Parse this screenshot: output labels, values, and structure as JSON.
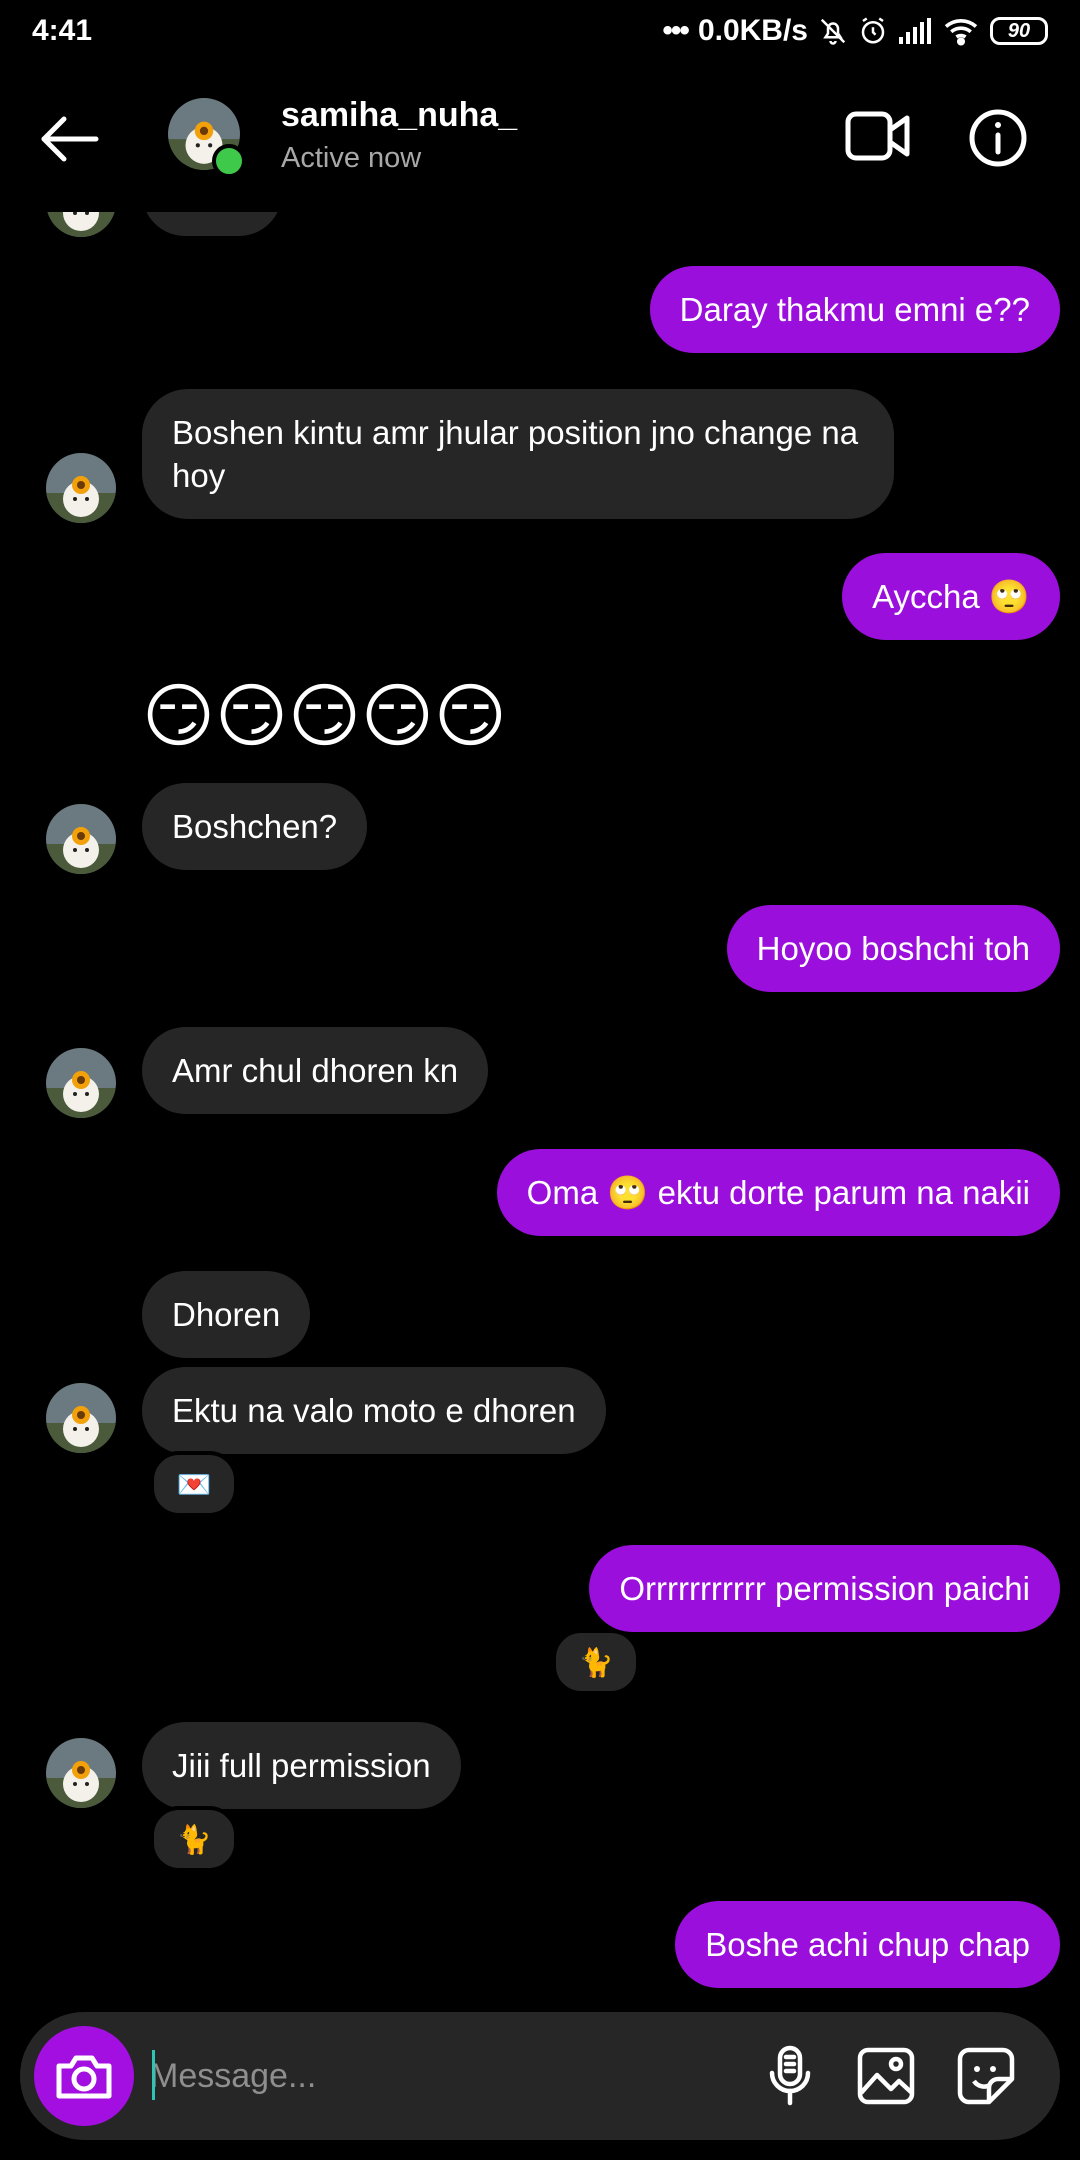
{
  "status_bar": {
    "time": "4:41",
    "network_speed": "0.0KB/s",
    "battery": "90"
  },
  "header": {
    "username": "samiha_nuha_",
    "status": "Active now"
  },
  "messages": {
    "m1": "Daray thakmu emni e??",
    "m2": "Boshen kintu amr jhular position jno change na hoy",
    "m3": "Ayccha 🙄",
    "m4_emojis": "😏😏😏😏😏",
    "m5": "Boshchen?",
    "m6": "Hoyoo boshchi toh",
    "m7": "Amr chul dhoren kn",
    "m8": "Oma 🙄 ektu dorte parum na nakii",
    "m9": "Dhoren",
    "m10": "Ektu na valo moto e dhoren",
    "m10_reaction": "💌",
    "m11": "Orrrrrrrrrrr permission paichi",
    "m11_reaction": "🐈",
    "m12": "Jiii full permission",
    "m12_reaction": "🐈",
    "m13": "Boshe achi chup chap"
  },
  "composer": {
    "placeholder": "Message..."
  },
  "colors": {
    "outgoing_bubble": "#9b0fdc",
    "incoming_bubble": "#262626",
    "active_indicator": "#3ec94a",
    "camera_button": "#a30fe0"
  }
}
